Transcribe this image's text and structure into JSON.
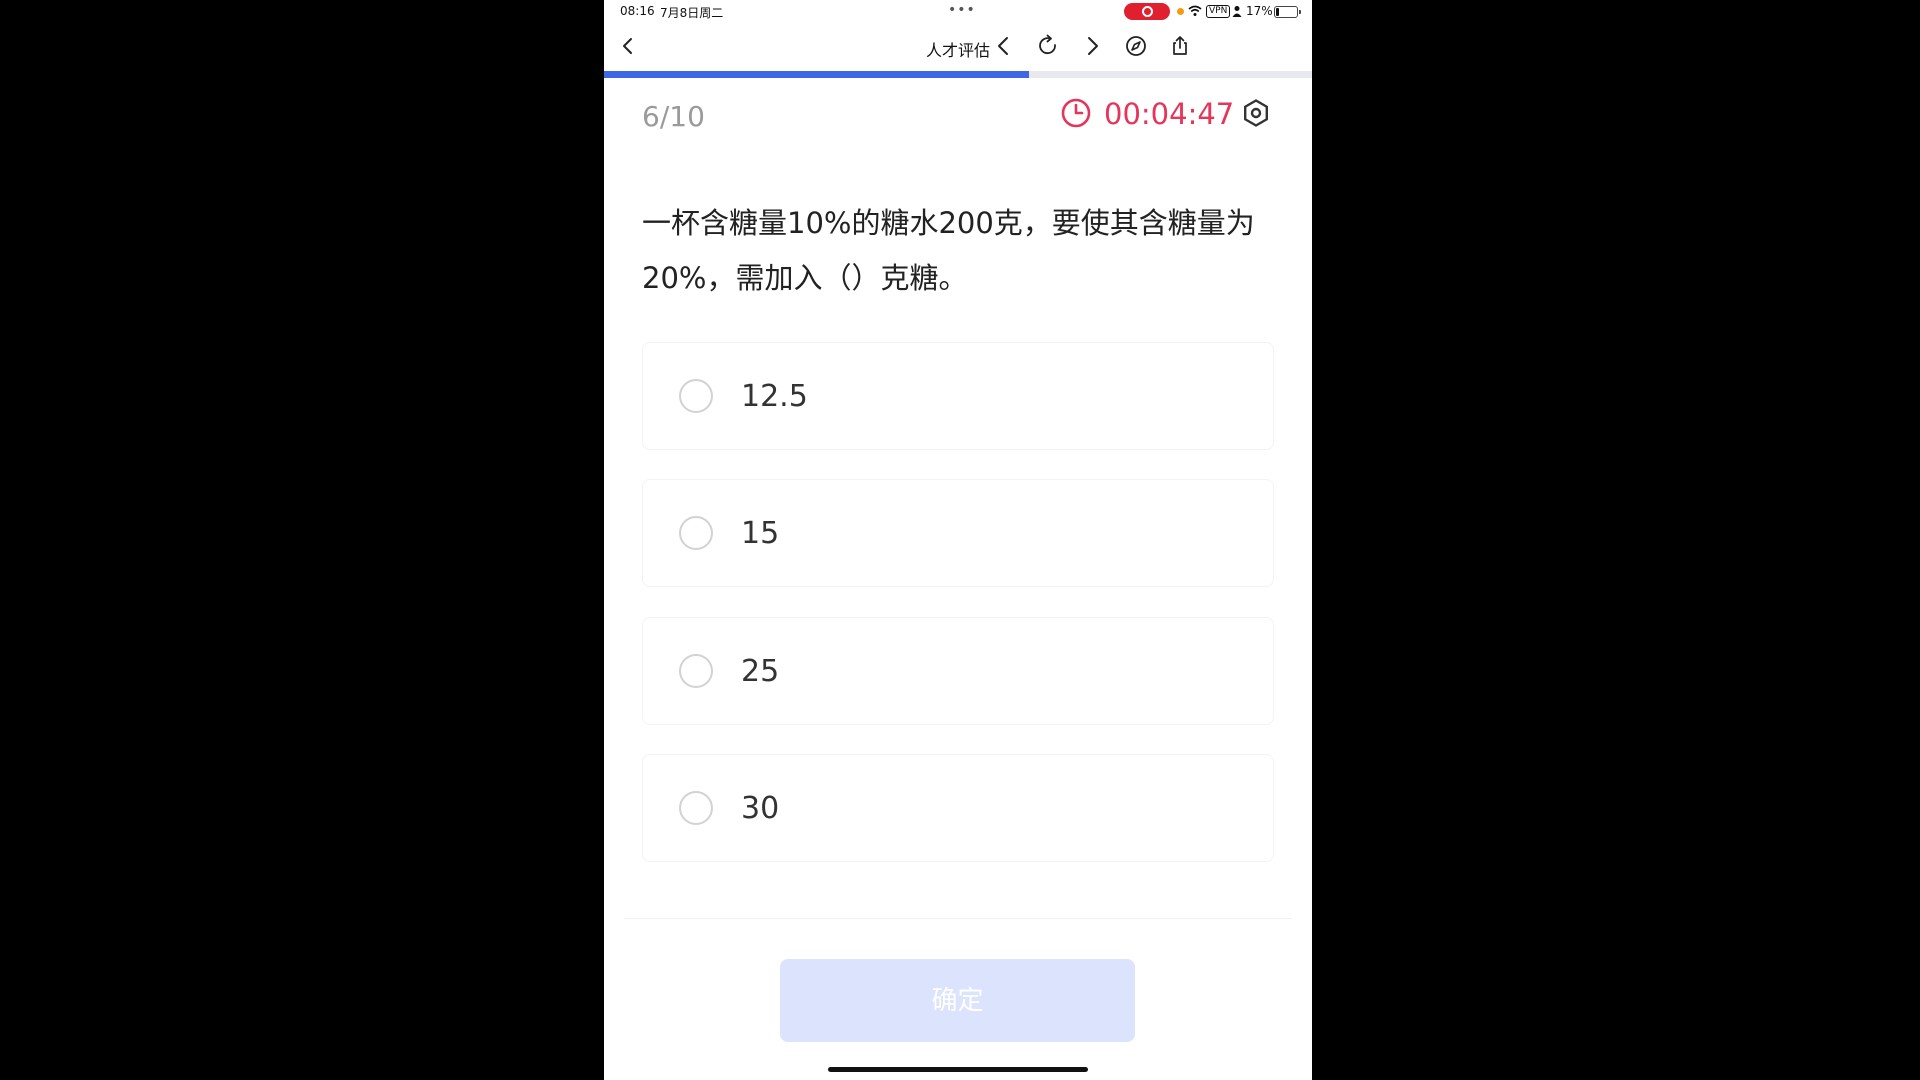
{
  "status_bar": {
    "time": "08:16",
    "date": "7月8日周二",
    "dots": "•••",
    "vpn": "VPN",
    "battery": "17%",
    "battery_level": 0.17
  },
  "nav": {
    "title": "人才评估"
  },
  "progress": {
    "current": 6,
    "total": 10,
    "fraction": 0.6
  },
  "header": {
    "counter": "6/10",
    "timer": "00:04:47"
  },
  "question": {
    "text": "一杯含糖量10%的糖水200克，要使其含糖量为20%，需加入（）克糖。"
  },
  "options": [
    {
      "label": "12.5"
    },
    {
      "label": "15"
    },
    {
      "label": "25"
    },
    {
      "label": "30"
    }
  ],
  "confirm": {
    "label": "确定"
  },
  "colors": {
    "accent": "#3e67e6",
    "timer": "#e6355a",
    "button_disabled": "#dce3fc"
  }
}
